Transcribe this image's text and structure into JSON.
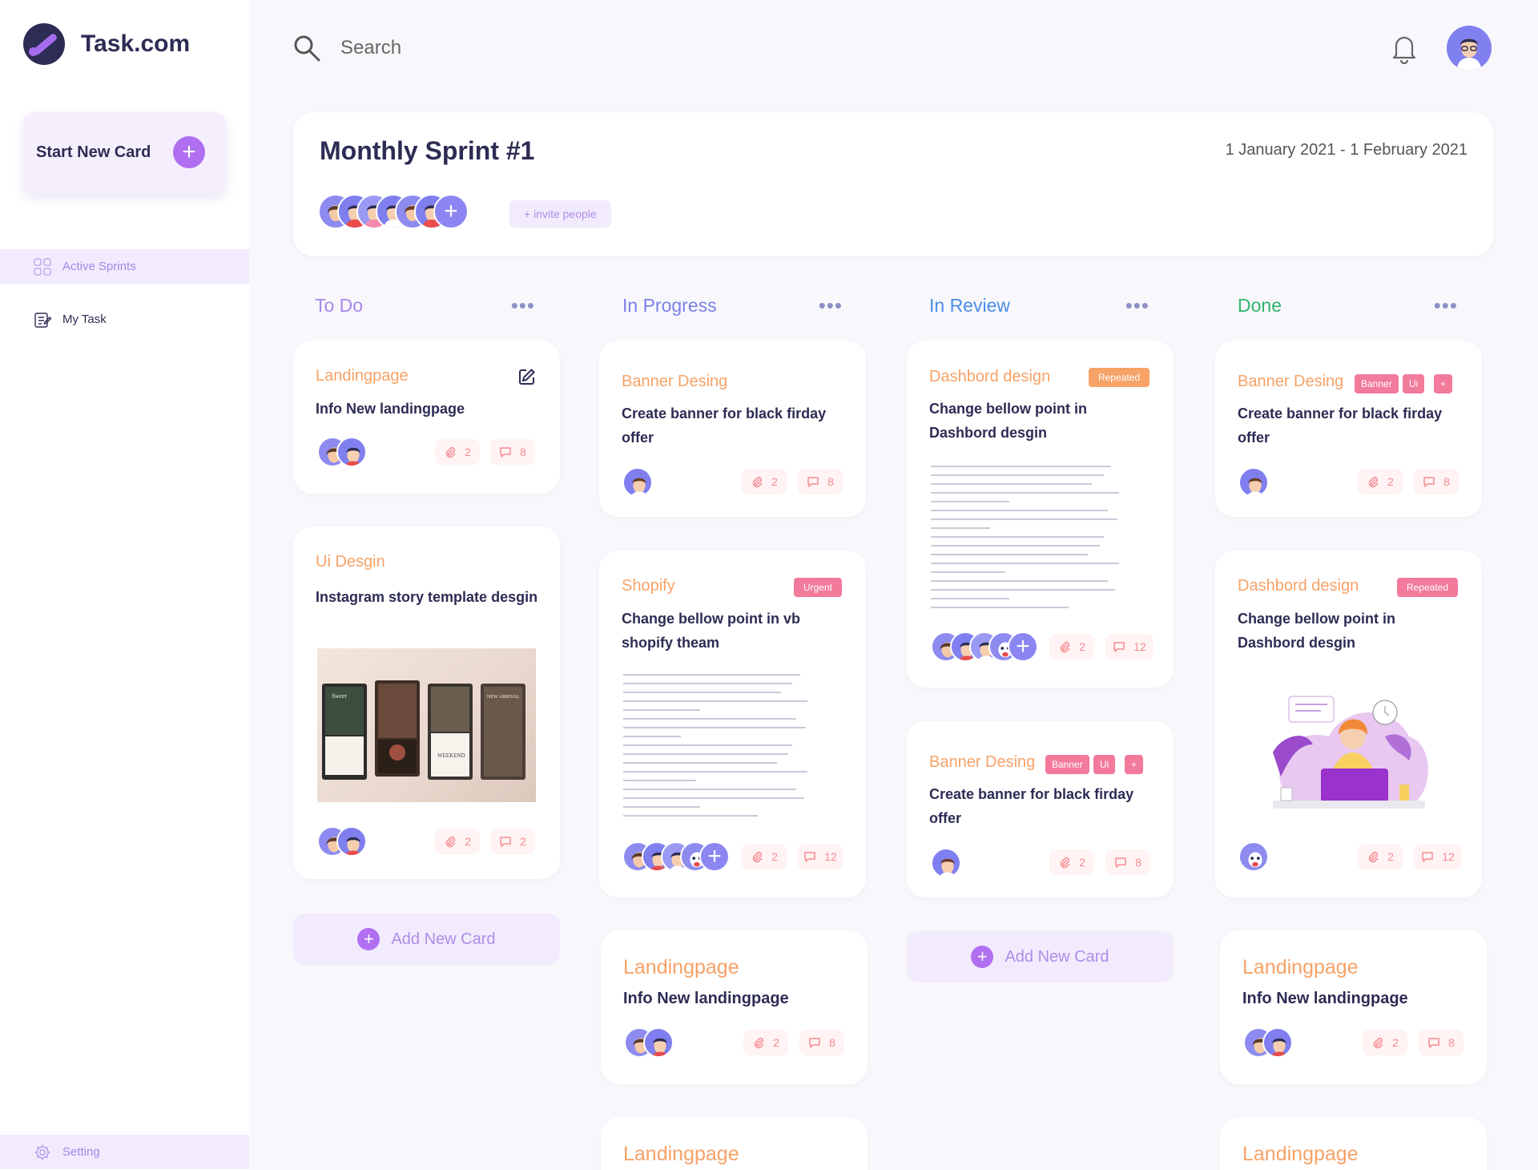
{
  "app": {
    "name": "Task.com"
  },
  "sidebar": {
    "start_card_label": "Start New Card",
    "items": [
      {
        "label": "Active Sprints",
        "icon": "grid-icon",
        "active": true
      },
      {
        "label": "My Task",
        "icon": "task-list-icon",
        "active": false
      }
    ],
    "setting_label": "Setting"
  },
  "header": {
    "search_placeholder": "Search"
  },
  "sprint": {
    "title": "Monthly Sprint #1",
    "date_range": "1 January 2021 - 1 February 2021",
    "invite_label": "+ invite people"
  },
  "colors": {
    "todo": "#a686e8",
    "in_progress": "#7b7fe8",
    "in_review": "#4a8ee8",
    "done": "#2eb46c",
    "category": "#f7a267",
    "urgent": "#f27a9b",
    "repeated": "#f7a267",
    "accent": "#b06ef0"
  },
  "columns": [
    {
      "title": "To Do",
      "add_label": "Add New Card",
      "cards": [
        {
          "category": "Landingpage",
          "title": "Info New landingpage",
          "attachments": "2",
          "comments": "8"
        },
        {
          "category": "Ui Desgin",
          "title": "Instagram story template desgin",
          "attachments": "2",
          "comments": "2"
        }
      ]
    },
    {
      "title": "In Progress",
      "cards": [
        {
          "category": "Banner Desing",
          "title": "Create banner for black firday offer",
          "attachments": "2",
          "comments": "8"
        },
        {
          "category": "Shopify",
          "tag": "Urgent",
          "title": "Change bellow point in vb shopify theam",
          "attachments": "2",
          "comments": "12"
        },
        {
          "category": "Landingpage",
          "title": "Info New landingpage",
          "attachments": "2",
          "comments": "8"
        },
        {
          "category": "Landingpage"
        }
      ]
    },
    {
      "title": "In Review",
      "add_label": "Add New Card",
      "cards": [
        {
          "category": "Dashbord design",
          "tag": "Repeated",
          "title": "Change bellow point in Dashbord desgin",
          "attachments": "2",
          "comments": "12"
        },
        {
          "category": "Banner Desing",
          "tags": [
            "Banner",
            "Ui",
            "+"
          ],
          "title": "Create banner for black firday offer",
          "attachments": "2",
          "comments": "8"
        }
      ]
    },
    {
      "title": "Done",
      "cards": [
        {
          "category": "Banner Desing",
          "tags": [
            "Banner",
            "Ui",
            "+"
          ],
          "title": "Create banner for black firday offer",
          "attachments": "2",
          "comments": "8"
        },
        {
          "category": "Dashbord design",
          "tag": "Repeated",
          "title": "Change bellow point in Dashbord desgin",
          "attachments": "2",
          "comments": "12"
        },
        {
          "category": "Landingpage",
          "title": "Info New landingpage",
          "attachments": "2",
          "comments": "8"
        },
        {
          "category": "Landingpage"
        }
      ]
    }
  ]
}
